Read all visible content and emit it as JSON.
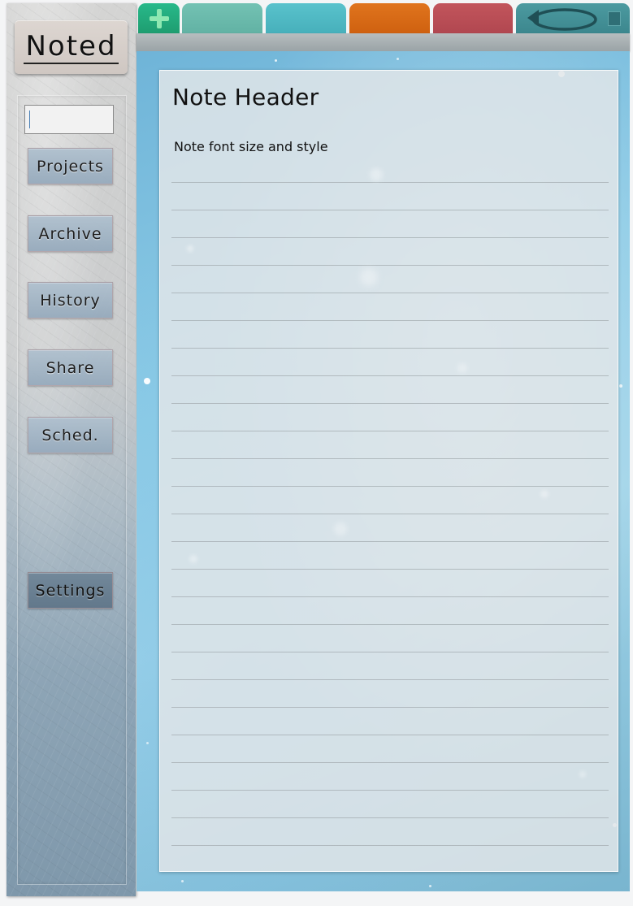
{
  "app": {
    "logo": "Noted"
  },
  "sidebar": {
    "search": {
      "value": "",
      "placeholder": ""
    },
    "items": [
      {
        "label": "Projects"
      },
      {
        "label": "Archive"
      },
      {
        "label": "History"
      },
      {
        "label": "Share"
      },
      {
        "label": "Sched."
      }
    ],
    "settings": {
      "label": "Settings"
    }
  },
  "tabs": [
    {
      "name": "add",
      "icon": "plus-icon",
      "color": "#22ab7d"
    },
    {
      "name": "teal",
      "color": "#6cbbad"
    },
    {
      "name": "cyan",
      "color": "#50b9c3"
    },
    {
      "name": "orange",
      "color": "#d86a16"
    },
    {
      "name": "red",
      "color": "#b94e56"
    },
    {
      "name": "undo",
      "icon": "undo-icon",
      "color": "#4491a0"
    }
  ],
  "note": {
    "header": "Note Header",
    "body_first_line": "Note font size and style"
  }
}
